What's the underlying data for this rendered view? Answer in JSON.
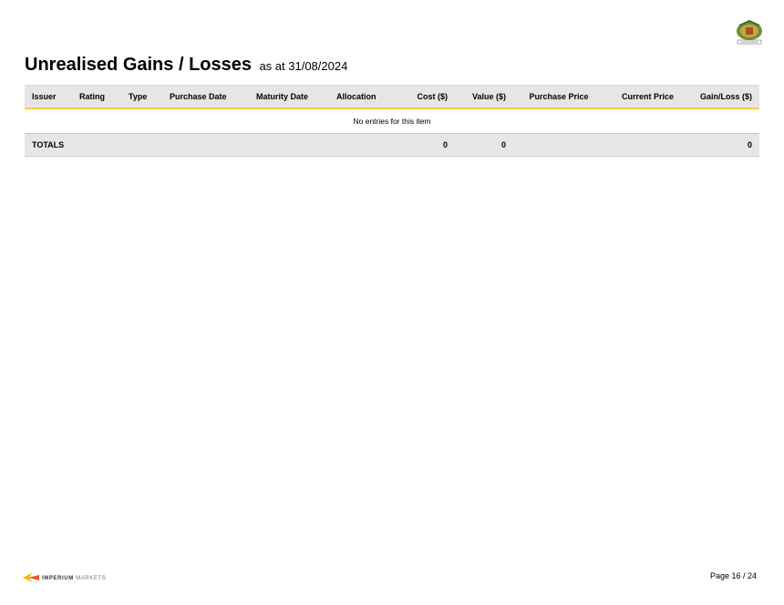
{
  "header": {
    "title": "Unrealised Gains / Losses",
    "subtitle": "as at 31/08/2024",
    "logo_icon": "council-crest-icon"
  },
  "table": {
    "columns": [
      "Issuer",
      "Rating",
      "Type",
      "Purchase Date",
      "Maturity Date",
      "Allocation",
      "Cost ($)",
      "Value ($)",
      "Purchase Price",
      "Current Price",
      "Gain/Loss ($)"
    ],
    "empty_message": "No entries for this item",
    "totals": {
      "label": "TOTALS",
      "cost": "0",
      "value": "0",
      "gain_loss": "0"
    }
  },
  "footer": {
    "brand_bold": "IMPERIUM",
    "brand_light": "MARKETS",
    "page": "Page 16 / 24"
  },
  "colors": {
    "accent": "#f7c948",
    "header_bg": "#e6e6e6"
  }
}
